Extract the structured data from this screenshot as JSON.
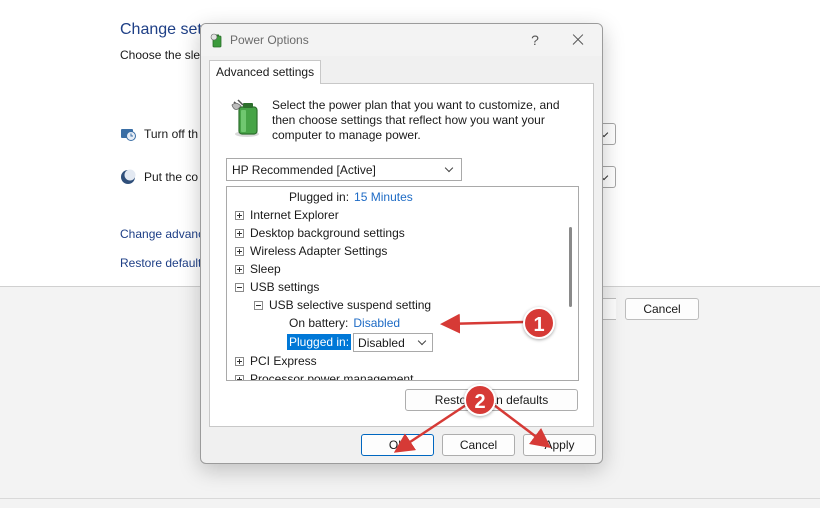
{
  "background": {
    "title": "Change sett",
    "subtitle": "Choose the slee",
    "turn_off_label": "Turn off th",
    "put_computer_label": "Put the co",
    "change_advanced_link": "Change advanc",
    "restore_default_link": "Restore default",
    "cancel_label": "Cancel"
  },
  "dialog": {
    "title": "Power Options",
    "help_glyph": "?",
    "tab_label": "Advanced settings",
    "intro_text": "Select the power plan that you want to customize, and then choose settings that reflect how you want your computer to manage power.",
    "plan_select_value": "HP Recommended [Active]",
    "tree": {
      "top_plugged_label": "Plugged in:",
      "top_plugged_value": "15 Minutes",
      "items": {
        "internet_explorer": "Internet Explorer",
        "desktop_background": "Desktop background settings",
        "wireless_adapter": "Wireless Adapter Settings",
        "sleep": "Sleep",
        "usb_settings": "USB settings",
        "usb_selective": "USB selective suspend setting",
        "pci_express": "PCI Express",
        "processor_power": "Processor power management"
      },
      "on_battery_label": "On battery:",
      "on_battery_value": "Disabled",
      "plugged_in_label": "Plugged in:",
      "plugged_in_value": "Disabled"
    },
    "restore_button": "Restore plan defaults",
    "ok_button": "OK",
    "cancel_button": "Cancel",
    "apply_button": "Apply"
  },
  "annotations": {
    "badge_1": "1",
    "badge_2": "2",
    "color": "#d63a36"
  },
  "icons": {
    "app_icon": "power-options-icon",
    "battery_icon": "battery-plug-icon",
    "clock_icon": "display-timer-icon",
    "moon_icon": "sleep-moon-icon"
  }
}
